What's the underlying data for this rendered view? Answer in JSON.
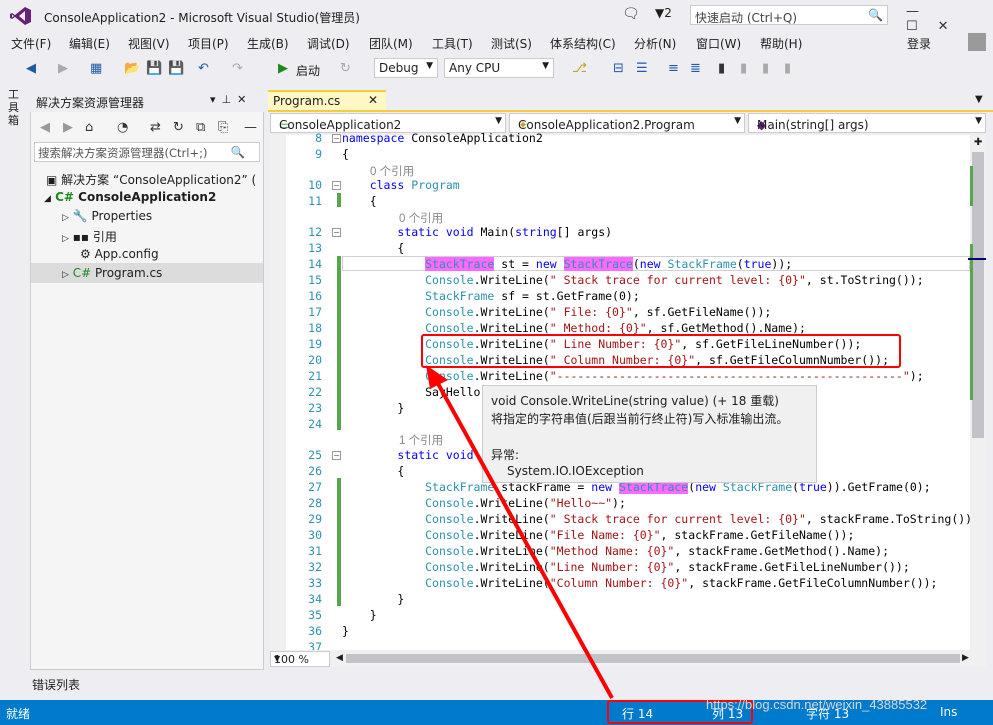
{
  "window": {
    "title": "ConsoleApplication2 - Microsoft Visual Studio(管理员)",
    "notification_count": "2",
    "quick_launch_placeholder": "快速启动 (Ctrl+Q)",
    "login": "登录"
  },
  "menu": [
    "文件(F)",
    "编辑(E)",
    "视图(V)",
    "项目(P)",
    "生成(B)",
    "调试(D)",
    "团队(M)",
    "工具(T)",
    "测试(S)",
    "体系结构(C)",
    "分析(N)",
    "窗口(W)",
    "帮助(H)"
  ],
  "toolbar": {
    "start_label": "启动",
    "config": "Debug",
    "platform": "Any CPU"
  },
  "toolbox_tab": "工具箱",
  "solution_explorer": {
    "title": "解决方案资源管理器",
    "search_placeholder": "搜索解决方案资源管理器(Ctrl+;)",
    "items": [
      {
        "label": "解决方案 “ConsoleApplication2” (",
        "icon": "solution-icon"
      },
      {
        "label": "ConsoleApplication2",
        "icon": "csharp-project-icon"
      },
      {
        "label": "Properties",
        "icon": "wrench-icon"
      },
      {
        "label": "引用",
        "icon": "references-icon"
      },
      {
        "label": "App.config",
        "icon": "config-file-icon"
      },
      {
        "label": "Program.cs",
        "icon": "csharp-file-icon"
      }
    ]
  },
  "editor": {
    "tab": "Program.cs",
    "nav": {
      "project": "ConsoleApplication2",
      "type": "ConsoleApplication2.Program",
      "member": "Main(string[] args)"
    },
    "zoom": "100 %",
    "ref0": "0 个引用",
    "ref1": "1 个引用"
  },
  "tooltip": {
    "signature": "void Console.WriteLine(string value)  (+ 18 重载)",
    "description": "将指定的字符串值(后跟当前行终止符)写入标准输出流。",
    "exceptions_label": "异常:",
    "exception": "System.IO.IOException"
  },
  "error_list_tab": "错误列表",
  "status": {
    "ready": "就绪",
    "line": "行 14",
    "col": "列 13",
    "char": "字符 13",
    "mode": "Ins"
  },
  "watermark": "https://blog.csdn.net/weixin_43885532",
  "colors": {
    "accent": "#007acc",
    "highlight": "#ff69ff",
    "annotation": "#ff0000"
  }
}
